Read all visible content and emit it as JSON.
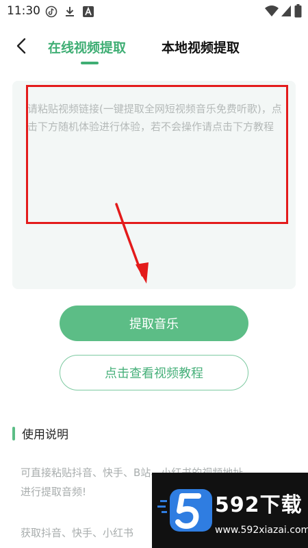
{
  "status_bar": {
    "time": "11:30",
    "icons": [
      "tiktok-icon",
      "download-icon",
      "font-icon",
      "wifi-icon",
      "signal-icon",
      "battery-icon"
    ]
  },
  "header": {
    "tabs": [
      {
        "label": "在线视频提取",
        "active": true
      },
      {
        "label": "本地视频提取",
        "active": false
      }
    ],
    "accent_color": "#3fae74"
  },
  "link_input": {
    "placeholder": "请粘贴视频链接(一键提取全网短视频音乐免费听歌)，点击下方随机体验进行体验，若不会操作请点击下方教程",
    "value": ""
  },
  "actions": {
    "extract_label": "提取音乐",
    "tutorial_label": "点击查看视频教程"
  },
  "instructions": {
    "title": "使用说明",
    "lines": [
      "可直接粘贴抖音、快手、B站、小红书的视频地址",
      "进行提取音频!",
      "获取抖音、快手、小红书"
    ]
  },
  "watermark": {
    "title": "592下载",
    "url": "www.592xiazai.com"
  },
  "annotation_color": "#e31b1b"
}
